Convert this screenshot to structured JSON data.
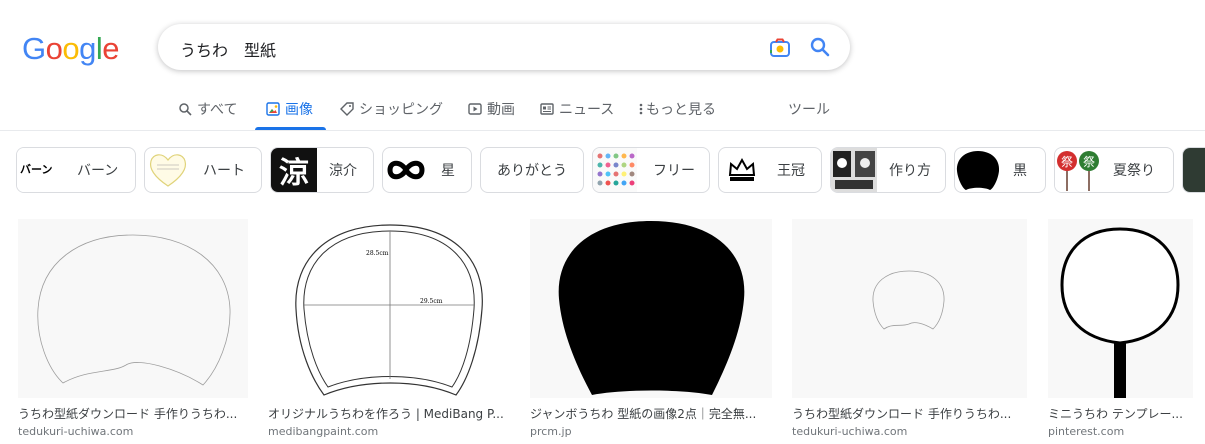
{
  "logo": {
    "letters": [
      "G",
      "o",
      "o",
      "g",
      "l",
      "e"
    ],
    "colors": [
      "#4285f4",
      "#ea4335",
      "#fbbc05",
      "#4285f4",
      "#34a853",
      "#ea4335"
    ]
  },
  "search": {
    "query": "うちわ　型紙"
  },
  "tabs": [
    {
      "label": "すべて",
      "icon": "search-icon"
    },
    {
      "label": "画像",
      "icon": "image-icon",
      "active": true
    },
    {
      "label": "ショッピング",
      "icon": "tag-icon"
    },
    {
      "label": "動画",
      "icon": "play-icon"
    },
    {
      "label": "ニュース",
      "icon": "news-icon"
    },
    {
      "label": "もっと見る",
      "icon": "more-vert-icon"
    },
    {
      "label": "ツール",
      "icon": ""
    }
  ],
  "chips": [
    {
      "label": "バーン",
      "thumb_text": "バーン"
    },
    {
      "label": "ハート"
    },
    {
      "label": "涼介",
      "thumb_text": "涼"
    },
    {
      "label": "星"
    },
    {
      "label": "ありがとう"
    },
    {
      "label": "フリー"
    },
    {
      "label": "王冠"
    },
    {
      "label": "作り方"
    },
    {
      "label": "黒"
    },
    {
      "label": "夏祭り",
      "thumb_text": "祭"
    }
  ],
  "results": [
    {
      "title": "うちわ型紙ダウンロード 手作りうちわ...",
      "site": "tedukuri-uchiwa.com"
    },
    {
      "title": "オリジナルうちわを作ろう | MediBang P...",
      "site": "medibangpaint.com",
      "dims": [
        "28.5cm",
        "29.5cm"
      ]
    },
    {
      "title": "ジャンボうちわ 型紙の画像2点｜完全無...",
      "site": "prcm.jp"
    },
    {
      "title": "うちわ型紙ダウンロード 手作りうちわ...",
      "site": "tedukuri-uchiwa.com"
    },
    {
      "title": "ミニうちわ テンプレー...",
      "site": "pinterest.com"
    }
  ]
}
